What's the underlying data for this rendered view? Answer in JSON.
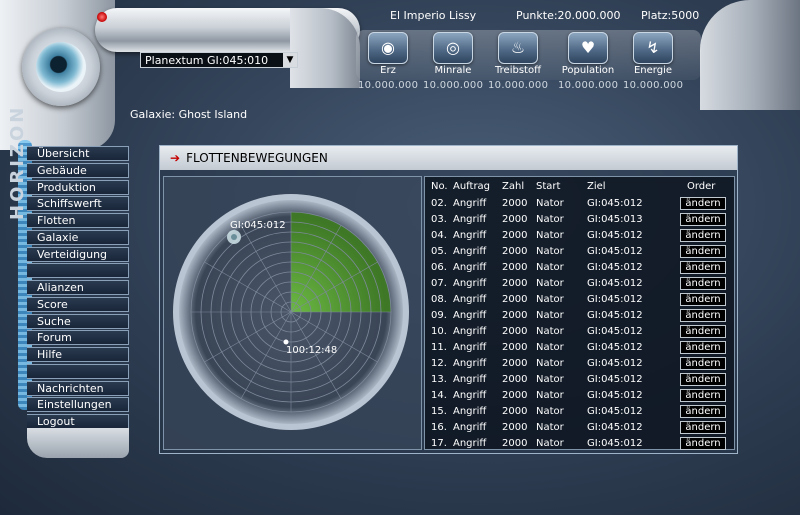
{
  "header": {
    "player": "El Imperio Lissy",
    "points": "Punkte:20.000.000",
    "place": "Platz:5000"
  },
  "logo": "HORIZON",
  "planet_select": {
    "value": "Planextum GI:045:010"
  },
  "resources": [
    {
      "label": "Erz",
      "value": "10.000.000",
      "icon": "ore-icon",
      "glyph": "◉"
    },
    {
      "label": "Minrale",
      "value": "10.000.000",
      "icon": "mineral-icon",
      "glyph": "◎"
    },
    {
      "label": "Treibstoff",
      "value": "10.000.000",
      "icon": "fuel-flame-icon",
      "glyph": "♨"
    },
    {
      "label": "Population",
      "value": "10.000.000",
      "icon": "heart-icon",
      "glyph": "♥"
    },
    {
      "label": "Energie",
      "value": "10.000.000",
      "icon": "energy-icon",
      "glyph": "↯"
    }
  ],
  "galaxy_label": "Galaxie: Ghost Island",
  "sidebar": {
    "group1": [
      "Übersicht",
      "Gebäude",
      "Produktion",
      "Schiffswerft",
      "Flotten",
      "Galaxie",
      "Verteidigung"
    ],
    "group2": [
      "Alianzen",
      "Score",
      "Suche",
      "Forum",
      "Hilfe"
    ],
    "group3": [
      "Nachrichten",
      "Einstellungen",
      "Logout"
    ]
  },
  "panel": {
    "title": "FLOTTENBEWEGUNGEN",
    "radar": {
      "target_label": "GI:045:012",
      "time_label": "100:12:48",
      "sweep_fraction": 0.25
    },
    "table": {
      "headers": [
        "No.",
        "Auftrag",
        "Zahl",
        "Start",
        "Ziel",
        "Order"
      ],
      "button_label": "ändern",
      "rows": [
        [
          "02.",
          "Angriff",
          "2000",
          "Nator",
          "GI:045:012"
        ],
        [
          "03.",
          "Angriff",
          "2000",
          "Nator",
          "GI:045:013"
        ],
        [
          "04.",
          "Angriff",
          "2000",
          "Nator",
          "GI:045:012"
        ],
        [
          "05.",
          "Angriff",
          "2000",
          "Nator",
          "GI:045:012"
        ],
        [
          "06.",
          "Angriff",
          "2000",
          "Nator",
          "GI:045:012"
        ],
        [
          "07.",
          "Angriff",
          "2000",
          "Nator",
          "GI:045:012"
        ],
        [
          "08.",
          "Angriff",
          "2000",
          "Nator",
          "GI:045:012"
        ],
        [
          "09.",
          "Angriff",
          "2000",
          "Nator",
          "GI:045:012"
        ],
        [
          "10.",
          "Angriff",
          "2000",
          "Nator",
          "GI:045:012"
        ],
        [
          "11.",
          "Angriff",
          "2000",
          "Nator",
          "GI:045:012"
        ],
        [
          "12.",
          "Angriff",
          "2000",
          "Nator",
          "GI:045:012"
        ],
        [
          "13.",
          "Angriff",
          "2000",
          "Nator",
          "GI:045:012"
        ],
        [
          "14.",
          "Angriff",
          "2000",
          "Nator",
          "GI:045:012"
        ],
        [
          "15.",
          "Angriff",
          "2000",
          "Nator",
          "GI:045:012"
        ],
        [
          "16.",
          "Angriff",
          "2000",
          "Nator",
          "GI:045:012"
        ],
        [
          "17.",
          "Angriff",
          "2000",
          "Nator",
          "GI:045:012"
        ]
      ]
    }
  },
  "colors": {
    "accent_red": "#c40000",
    "radar_green": "#4c9a2a",
    "panel_border": "#9fb3c8"
  }
}
